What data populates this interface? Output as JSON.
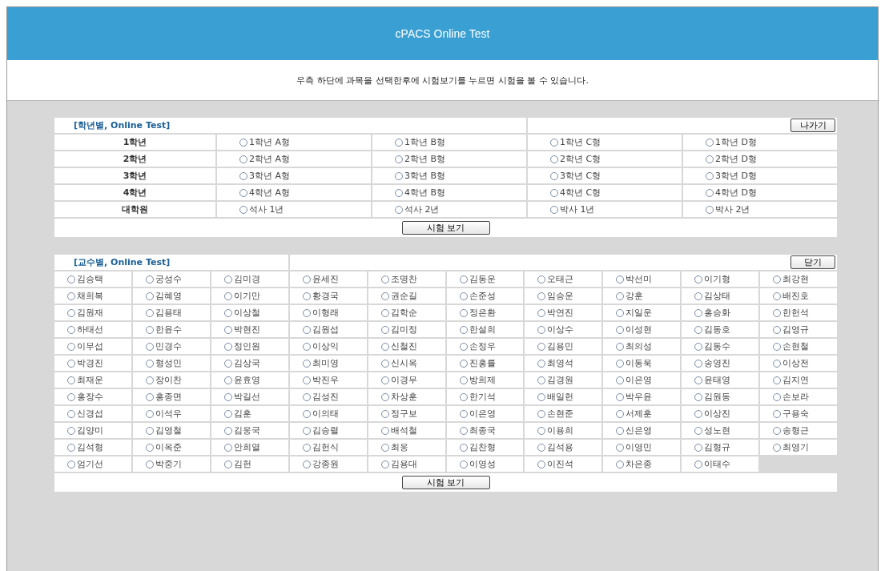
{
  "header": {
    "title": "cPACS Online Test"
  },
  "notice": "우측 하단에 과목을 선택한후에 시험보기를 누르면 시험을 볼 수 있습니다.",
  "student_test": {
    "title": "[학년별, Online Test]",
    "exit_button": "나가기",
    "submit_button": "시험 보기",
    "rows": [
      {
        "label": "1학년",
        "options": [
          {
            "label": "1학년 A형",
            "selected": false
          },
          {
            "label": "1학년 B형",
            "selected": false
          },
          {
            "label": "1학년 C형",
            "selected": false
          },
          {
            "label": "1학년 D형",
            "selected": false
          }
        ]
      },
      {
        "label": "2학년",
        "options": [
          {
            "label": "2학년 A형",
            "selected": false
          },
          {
            "label": "2학년 B형",
            "selected": false
          },
          {
            "label": "2학년 C형",
            "selected": false
          },
          {
            "label": "2학년 D형",
            "selected": false
          }
        ]
      },
      {
        "label": "3학년",
        "options": [
          {
            "label": "3학년 A형",
            "selected": false
          },
          {
            "label": "3학년 B형",
            "selected": false
          },
          {
            "label": "3학년 C형",
            "selected": false
          },
          {
            "label": "3학년 D형",
            "selected": false
          }
        ]
      },
      {
        "label": "4학년",
        "options": [
          {
            "label": "4학년 A형",
            "selected": false
          },
          {
            "label": "4학년 B형",
            "selected": false
          },
          {
            "label": "4학년 C형",
            "selected": false
          },
          {
            "label": "4학년 D형",
            "selected": false
          }
        ]
      },
      {
        "label": "대학원",
        "options": [
          {
            "label": "석사 1년",
            "selected": false
          },
          {
            "label": "석사 2년",
            "selected": false
          },
          {
            "label": "박사 1년",
            "selected": false
          },
          {
            "label": "박사 2년",
            "selected": false
          }
        ]
      }
    ]
  },
  "professor_test": {
    "title": "[교수별, Online Test]",
    "close_button": "닫기",
    "submit_button": "시험 보기",
    "options": [
      {
        "label": "김승택",
        "selected": false
      },
      {
        "label": "궁성수",
        "selected": false
      },
      {
        "label": "김미경",
        "selected": false
      },
      {
        "label": "윤세진",
        "selected": false
      },
      {
        "label": "조명찬",
        "selected": false
      },
      {
        "label": "김동운",
        "selected": false
      },
      {
        "label": "오태근",
        "selected": false
      },
      {
        "label": "박선미",
        "selected": false
      },
      {
        "label": "이기형",
        "selected": false
      },
      {
        "label": "최강현",
        "selected": false
      },
      {
        "label": "채희복",
        "selected": false
      },
      {
        "label": "김혜영",
        "selected": false
      },
      {
        "label": "이기만",
        "selected": false
      },
      {
        "label": "황경국",
        "selected": false
      },
      {
        "label": "권순길",
        "selected": false
      },
      {
        "label": "손준성",
        "selected": false
      },
      {
        "label": "임승운",
        "selected": false
      },
      {
        "label": "강훈",
        "selected": false
      },
      {
        "label": "김상태",
        "selected": false
      },
      {
        "label": "배진호",
        "selected": false
      },
      {
        "label": "김원재",
        "selected": false
      },
      {
        "label": "김용태",
        "selected": false
      },
      {
        "label": "이상철",
        "selected": false
      },
      {
        "label": "이형래",
        "selected": false
      },
      {
        "label": "김학순",
        "selected": false
      },
      {
        "label": "정은환",
        "selected": false
      },
      {
        "label": "박연진",
        "selected": false
      },
      {
        "label": "지일운",
        "selected": false
      },
      {
        "label": "홍승화",
        "selected": false
      },
      {
        "label": "한헌석",
        "selected": false
      },
      {
        "label": "하태선",
        "selected": false
      },
      {
        "label": "한윤수",
        "selected": false
      },
      {
        "label": "박현진",
        "selected": false
      },
      {
        "label": "김원섭",
        "selected": false
      },
      {
        "label": "김미정",
        "selected": false
      },
      {
        "label": "한설희",
        "selected": false
      },
      {
        "label": "이상수",
        "selected": false
      },
      {
        "label": "이성현",
        "selected": false
      },
      {
        "label": "김동호",
        "selected": false
      },
      {
        "label": "김영규",
        "selected": false
      },
      {
        "label": "이무섭",
        "selected": false
      },
      {
        "label": "민경수",
        "selected": false
      },
      {
        "label": "정인원",
        "selected": false
      },
      {
        "label": "이상익",
        "selected": false
      },
      {
        "label": "신철진",
        "selected": false
      },
      {
        "label": "손정우",
        "selected": false
      },
      {
        "label": "김용민",
        "selected": false
      },
      {
        "label": "최의성",
        "selected": false
      },
      {
        "label": "김동수",
        "selected": false
      },
      {
        "label": "손현철",
        "selected": false
      },
      {
        "label": "박경진",
        "selected": false
      },
      {
        "label": "형성민",
        "selected": false
      },
      {
        "label": "김상국",
        "selected": false
      },
      {
        "label": "최미영",
        "selected": false
      },
      {
        "label": "신시옥",
        "selected": false
      },
      {
        "label": "진홍률",
        "selected": false
      },
      {
        "label": "최영석",
        "selected": false
      },
      {
        "label": "이동욱",
        "selected": false
      },
      {
        "label": "송영진",
        "selected": false
      },
      {
        "label": "이상전",
        "selected": false
      },
      {
        "label": "최재운",
        "selected": false
      },
      {
        "label": "장이찬",
        "selected": false
      },
      {
        "label": "윤효영",
        "selected": false
      },
      {
        "label": "박진우",
        "selected": false
      },
      {
        "label": "이경무",
        "selected": false
      },
      {
        "label": "방희제",
        "selected": false
      },
      {
        "label": "김경원",
        "selected": false
      },
      {
        "label": "이은영",
        "selected": false
      },
      {
        "label": "윤태영",
        "selected": false
      },
      {
        "label": "김지연",
        "selected": false
      },
      {
        "label": "홍장수",
        "selected": false
      },
      {
        "label": "홍종면",
        "selected": false
      },
      {
        "label": "박길선",
        "selected": false
      },
      {
        "label": "김성진",
        "selected": false
      },
      {
        "label": "차상훈",
        "selected": false
      },
      {
        "label": "한기석",
        "selected": false
      },
      {
        "label": "배일헌",
        "selected": false
      },
      {
        "label": "박우윤",
        "selected": false
      },
      {
        "label": "김원동",
        "selected": false
      },
      {
        "label": "손보라",
        "selected": false
      },
      {
        "label": "신경섭",
        "selected": false
      },
      {
        "label": "이석우",
        "selected": false
      },
      {
        "label": "김훈",
        "selected": false
      },
      {
        "label": "이의태",
        "selected": false
      },
      {
        "label": "정구보",
        "selected": false
      },
      {
        "label": "이은영",
        "selected": false
      },
      {
        "label": "손현준",
        "selected": false
      },
      {
        "label": "서제훈",
        "selected": false
      },
      {
        "label": "이상진",
        "selected": false
      },
      {
        "label": "구용숙",
        "selected": false
      },
      {
        "label": "김양미",
        "selected": false
      },
      {
        "label": "김영철",
        "selected": false
      },
      {
        "label": "김웅국",
        "selected": false
      },
      {
        "label": "김승렬",
        "selected": false
      },
      {
        "label": "배석철",
        "selected": false
      },
      {
        "label": "최종국",
        "selected": false
      },
      {
        "label": "이용희",
        "selected": false
      },
      {
        "label": "신은영",
        "selected": false
      },
      {
        "label": "성노현",
        "selected": false
      },
      {
        "label": "송형근",
        "selected": false
      },
      {
        "label": "김석형",
        "selected": false
      },
      {
        "label": "이옥준",
        "selected": false
      },
      {
        "label": "안희열",
        "selected": false
      },
      {
        "label": "김헌식",
        "selected": false
      },
      {
        "label": "최웅",
        "selected": false
      },
      {
        "label": "김찬형",
        "selected": false
      },
      {
        "label": "김석용",
        "selected": false
      },
      {
        "label": "이영민",
        "selected": false
      },
      {
        "label": "김형규",
        "selected": false
      },
      {
        "label": "최영기",
        "selected": false
      },
      {
        "label": "엄기선",
        "selected": false
      },
      {
        "label": "박중기",
        "selected": false
      },
      {
        "label": "김헌",
        "selected": false
      },
      {
        "label": "강종원",
        "selected": false
      },
      {
        "label": "김용대",
        "selected": false
      },
      {
        "label": "이영성",
        "selected": false
      },
      {
        "label": "이진석",
        "selected": false
      },
      {
        "label": "차은종",
        "selected": false
      },
      {
        "label": "이태수",
        "selected": false
      }
    ]
  }
}
